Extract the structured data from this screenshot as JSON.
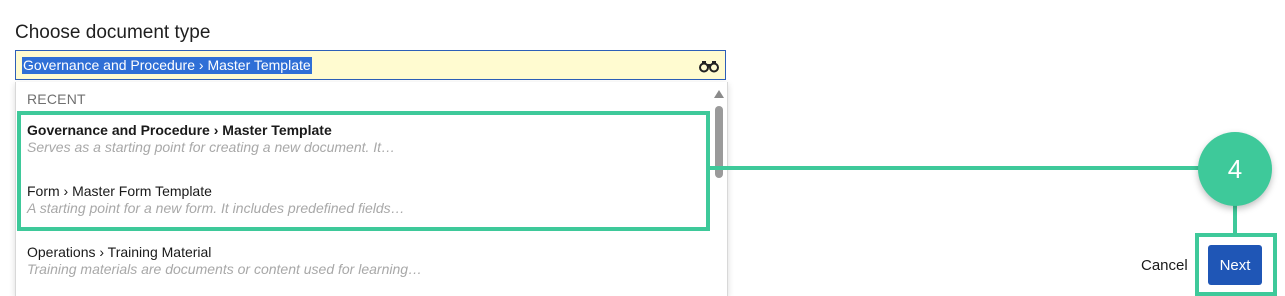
{
  "dialog": {
    "title": "Choose document type"
  },
  "doc_type_field": {
    "value": "Governance and Procedure › Master Template",
    "icon": "binoculars-icon"
  },
  "dropdown": {
    "section_header": "RECENT",
    "items": [
      {
        "title": "Governance and Procedure › Master Template",
        "description": "Serves as a starting point for creating a new document. It…"
      },
      {
        "title": "Form › Master Form Template",
        "description": "A starting point for a new form. It includes predefined fields…"
      },
      {
        "title": "Operations › Training Material",
        "description": "Training materials are documents or content used for learning…"
      }
    ]
  },
  "annotation": {
    "step_number": "4",
    "color": "#3ec99a"
  },
  "actions": {
    "cancel_label": "Cancel",
    "next_label": "Next"
  }
}
